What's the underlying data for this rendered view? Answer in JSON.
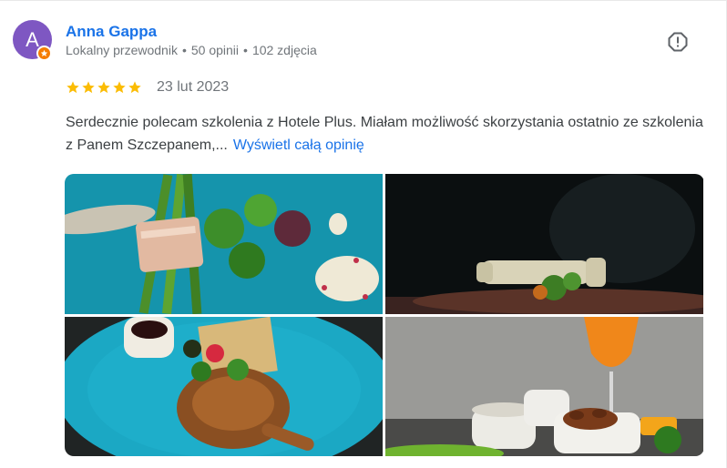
{
  "reviewer": {
    "initial": "A",
    "name": "Anna Gappa",
    "level": "Lokalny przewodnik",
    "reviews": "50 opinii",
    "photos": "102 zdjęcia",
    "separator": "•"
  },
  "review": {
    "rating": 5,
    "date": "23 lut 2023",
    "text": "Serdecznie polecam szkolenia z Hotele Plus. Miałam możliwość skorzystania ostatnio ze szkolenia z Panem Szczepanem,...",
    "more_label": "Wyświetl całą opinię"
  },
  "colors": {
    "avatar": "#7e57c2",
    "badge": "#f57c00",
    "link": "#1a73e8",
    "star": "#fbbc04"
  },
  "icons": {
    "report": "report-flag-icon",
    "badge": "local-guide-star-icon",
    "star": "star-icon"
  }
}
